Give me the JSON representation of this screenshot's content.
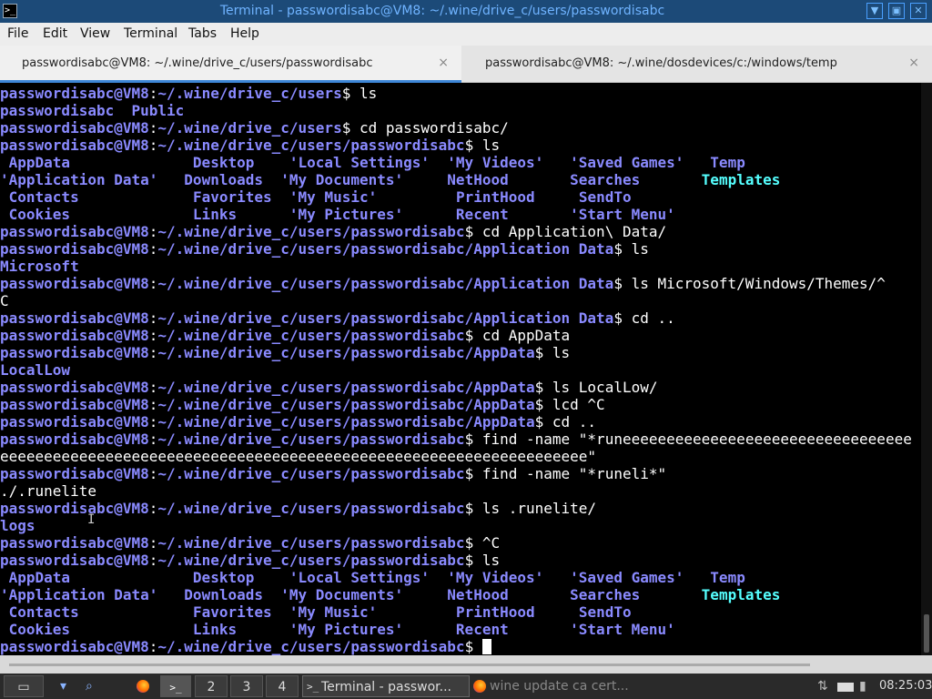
{
  "window": {
    "title": "Terminal - passwordisabc@VM8: ~/.wine/drive_c/users/passwordisabc",
    "icons": [
      "terminal-icon",
      "pin-icon",
      "maximize-icon",
      "close-icon"
    ],
    "colors": {
      "titlebar_bg": "#1c4a78",
      "title_text": "#6fb3ff"
    }
  },
  "menu": {
    "file": "File",
    "edit": "Edit",
    "view": "View",
    "terminal": "Terminal",
    "tabs": "Tabs",
    "help": "Help"
  },
  "tabs": [
    {
      "label": "passwordisabc@VM8: ~/.wine/drive_c/users/passwordisabc",
      "active": true,
      "close": "×"
    },
    {
      "label": "passwordisabc@VM8: ~/.wine/dosdevices/c:/windows/temp",
      "active": false,
      "close": "×"
    }
  ],
  "terminal": {
    "colors": {
      "bg": "#000000",
      "prompt": "#8a8aff",
      "dir": "#8a8aff",
      "file_cyan": "#55ffff",
      "text": "#ffffff"
    },
    "user_host": "passwordisabc@VM8",
    "lines": [
      {
        "t": "prompt",
        "path": "~/.wine/drive_c/users",
        "cmd": " ls"
      },
      {
        "t": "out",
        "segs": [
          {
            "s": "passwordisabc",
            "c": "d"
          },
          {
            "s": "  "
          },
          {
            "s": "Public",
            "c": "d"
          }
        ]
      },
      {
        "t": "prompt",
        "path": "~/.wine/drive_c/users",
        "cmd": " cd passwordisabc/"
      },
      {
        "t": "prompt",
        "path": "~/.wine/drive_c/users/passwordisabc",
        "cmd": " ls"
      },
      {
        "t": "out",
        "segs": [
          {
            "s": " AppData",
            "c": "d"
          },
          {
            "s": "              "
          },
          {
            "s": "Desktop",
            "c": "d"
          },
          {
            "s": "    "
          },
          {
            "s": "'Local Settings'",
            "c": "d"
          },
          {
            "s": "  "
          },
          {
            "s": "'My Videos'",
            "c": "d"
          },
          {
            "s": "   "
          },
          {
            "s": "'Saved Games'",
            "c": "d"
          },
          {
            "s": "   "
          },
          {
            "s": "Temp",
            "c": "d"
          }
        ]
      },
      {
        "t": "out",
        "segs": [
          {
            "s": "'Application Data'",
            "c": "d"
          },
          {
            "s": "   "
          },
          {
            "s": "Downloads",
            "c": "d"
          },
          {
            "s": "  "
          },
          {
            "s": "'My Documents'",
            "c": "d"
          },
          {
            "s": "     "
          },
          {
            "s": "NetHood",
            "c": "d"
          },
          {
            "s": "       "
          },
          {
            "s": "Searches",
            "c": "d"
          },
          {
            "s": "       "
          },
          {
            "s": "Templates",
            "c": "f"
          }
        ]
      },
      {
        "t": "out",
        "segs": [
          {
            "s": " Contacts",
            "c": "d"
          },
          {
            "s": "             "
          },
          {
            "s": "Favorites",
            "c": "d"
          },
          {
            "s": "  "
          },
          {
            "s": "'My Music'",
            "c": "d"
          },
          {
            "s": "         "
          },
          {
            "s": "PrintHood",
            "c": "d"
          },
          {
            "s": "     "
          },
          {
            "s": "SendTo",
            "c": "d"
          }
        ]
      },
      {
        "t": "out",
        "segs": [
          {
            "s": " Cookies",
            "c": "d"
          },
          {
            "s": "              "
          },
          {
            "s": "Links",
            "c": "d"
          },
          {
            "s": "      "
          },
          {
            "s": "'My Pictures'",
            "c": "d"
          },
          {
            "s": "      "
          },
          {
            "s": "Recent",
            "c": "d"
          },
          {
            "s": "       "
          },
          {
            "s": "'Start Menu'",
            "c": "d"
          }
        ]
      },
      {
        "t": "prompt",
        "path": "~/.wine/drive_c/users/passwordisabc",
        "cmd": " cd Application\\ Data/"
      },
      {
        "t": "prompt",
        "path": "~/.wine/drive_c/users/passwordisabc/Application Data",
        "cmd": " ls"
      },
      {
        "t": "out",
        "segs": [
          {
            "s": "Microsoft",
            "c": "d"
          }
        ]
      },
      {
        "t": "prompt",
        "path": "~/.wine/drive_c/users/passwordisabc/Application Data",
        "cmd": " ls Microsoft/Windows/Themes/^"
      },
      {
        "t": "out",
        "segs": [
          {
            "s": "C"
          }
        ]
      },
      {
        "t": "prompt",
        "path": "~/.wine/drive_c/users/passwordisabc/Application Data",
        "cmd": " cd .."
      },
      {
        "t": "prompt",
        "path": "~/.wine/drive_c/users/passwordisabc",
        "cmd": " cd AppData"
      },
      {
        "t": "prompt",
        "path": "~/.wine/drive_c/users/passwordisabc/AppData",
        "cmd": " ls"
      },
      {
        "t": "out",
        "segs": [
          {
            "s": "LocalLow",
            "c": "d"
          }
        ]
      },
      {
        "t": "prompt",
        "path": "~/.wine/drive_c/users/passwordisabc/AppData",
        "cmd": " ls LocalLow/"
      },
      {
        "t": "prompt",
        "path": "~/.wine/drive_c/users/passwordisabc/AppData",
        "cmd": " lcd ^C"
      },
      {
        "t": "prompt",
        "path": "~/.wine/drive_c/users/passwordisabc/AppData",
        "cmd": " cd .."
      },
      {
        "t": "prompt",
        "path": "~/.wine/drive_c/users/passwordisabc",
        "cmd": " find -name \"*runeeeeeeeeeeeeeeeeeeeeeeeeeeeeeeeee"
      },
      {
        "t": "out",
        "segs": [
          {
            "s": "eeeeeeeeeeeeeeeeeeeeeeeeeeeeeeeeeeeeeeeeeeeeeeeeeeeeeeeeeeeeeeeeeee\""
          }
        ]
      },
      {
        "t": "prompt",
        "path": "~/.wine/drive_c/users/passwordisabc",
        "cmd": " find -name \"*runeli*\""
      },
      {
        "t": "out",
        "segs": [
          {
            "s": "./.runelite"
          }
        ]
      },
      {
        "t": "prompt",
        "path": "~/.wine/drive_c/users/passwordisabc",
        "cmd": " ls .runelite/"
      },
      {
        "t": "out",
        "segs": [
          {
            "s": "logs",
            "c": "d"
          }
        ]
      },
      {
        "t": "prompt",
        "path": "~/.wine/drive_c/users/passwordisabc",
        "cmd": " ^C"
      },
      {
        "t": "prompt",
        "path": "~/.wine/drive_c/users/passwordisabc",
        "cmd": " ls"
      },
      {
        "t": "out",
        "segs": [
          {
            "s": " AppData",
            "c": "d"
          },
          {
            "s": "              "
          },
          {
            "s": "Desktop",
            "c": "d"
          },
          {
            "s": "    "
          },
          {
            "s": "'Local Settings'",
            "c": "d"
          },
          {
            "s": "  "
          },
          {
            "s": "'My Videos'",
            "c": "d"
          },
          {
            "s": "   "
          },
          {
            "s": "'Saved Games'",
            "c": "d"
          },
          {
            "s": "   "
          },
          {
            "s": "Temp",
            "c": "d"
          }
        ]
      },
      {
        "t": "out",
        "segs": [
          {
            "s": "'Application Data'",
            "c": "d"
          },
          {
            "s": "   "
          },
          {
            "s": "Downloads",
            "c": "d"
          },
          {
            "s": "  "
          },
          {
            "s": "'My Documents'",
            "c": "d"
          },
          {
            "s": "     "
          },
          {
            "s": "NetHood",
            "c": "d"
          },
          {
            "s": "       "
          },
          {
            "s": "Searches",
            "c": "d"
          },
          {
            "s": "       "
          },
          {
            "s": "Templates",
            "c": "f"
          }
        ]
      },
      {
        "t": "out",
        "segs": [
          {
            "s": " Contacts",
            "c": "d"
          },
          {
            "s": "             "
          },
          {
            "s": "Favorites",
            "c": "d"
          },
          {
            "s": "  "
          },
          {
            "s": "'My Music'",
            "c": "d"
          },
          {
            "s": "         "
          },
          {
            "s": "PrintHood",
            "c": "d"
          },
          {
            "s": "     "
          },
          {
            "s": "SendTo",
            "c": "d"
          }
        ]
      },
      {
        "t": "out",
        "segs": [
          {
            "s": " Cookies",
            "c": "d"
          },
          {
            "s": "              "
          },
          {
            "s": "Links",
            "c": "d"
          },
          {
            "s": "      "
          },
          {
            "s": "'My Pictures'",
            "c": "d"
          },
          {
            "s": "      "
          },
          {
            "s": "Recent",
            "c": "d"
          },
          {
            "s": "       "
          },
          {
            "s": "'Start Menu'",
            "c": "d"
          }
        ]
      },
      {
        "t": "prompt",
        "path": "~/.wine/drive_c/users/passwordisabc",
        "cmd": " ",
        "cursor": true
      }
    ]
  },
  "taskbar": {
    "workspaces": [
      "2",
      "3",
      "4"
    ],
    "tasks": [
      {
        "label": "Terminal - passwor...",
        "icon": "terminal-icon",
        "active": true
      },
      {
        "label": "wine update ca cert...",
        "icon": "firefox-icon",
        "active": false
      }
    ],
    "clock": "08:25:03",
    "icons": [
      "show-desktop-icon",
      "window-menu-icon",
      "search-icon",
      "firefox-icon",
      "terminal-icon",
      "network-icon",
      "volume-icon",
      "battery-icon"
    ]
  }
}
